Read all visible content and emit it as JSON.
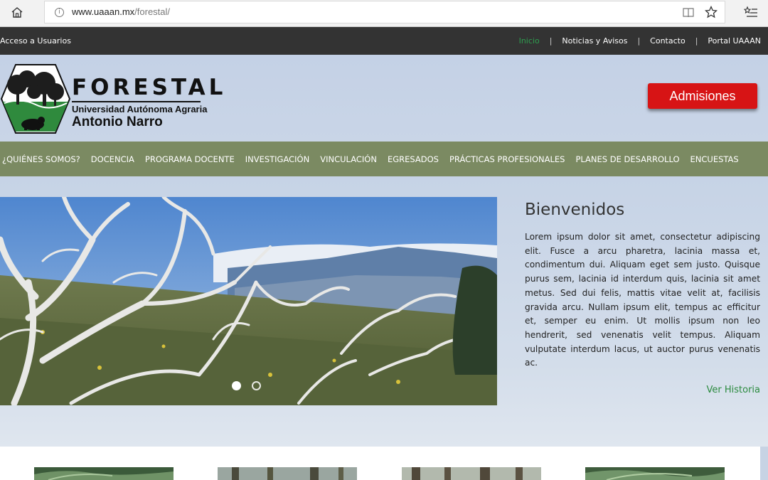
{
  "browser": {
    "url_host": "www.uaaan.mx",
    "url_path": "/forestal/",
    "icons": [
      "home-icon",
      "info-icon",
      "reading-view-icon",
      "favorite-star-icon",
      "favorites-hub-icon"
    ]
  },
  "topbar": {
    "left_link": "Acceso a Usuarios",
    "nav": [
      {
        "label": "Inicio",
        "active": true
      },
      {
        "label": "Noticias y Avisos",
        "active": false
      },
      {
        "label": "Contacto",
        "active": false
      },
      {
        "label": "Portal UAAAN",
        "active": false
      }
    ],
    "separator": "|"
  },
  "header": {
    "logo_title": "FORESTAL",
    "logo_subtitle": "Universidad Autónoma Agraria",
    "logo_name": "Antonio Narro",
    "admissions_label": "Admisiones"
  },
  "mainnav": {
    "items": [
      "¿QUIÉNES SOMOS?",
      "DOCENCIA",
      "PROGRAMA DOCENTE",
      "INVESTIGACIÓN",
      "VINCULACIÓN",
      "EGRESADOS",
      "PRÁCTICAS PROFESIONALES",
      "PLANES DE DESARROLLO",
      "ENCUESTAS"
    ]
  },
  "slider": {
    "slide_count": 2,
    "active_index": 0
  },
  "welcome": {
    "title": "Bienvenidos",
    "text": "Lorem ipsum dolor sit amet, consectetur adipiscing elit. Fusce a arcu pharetra, lacinia massa et, condimentum dui. Aliquam eget sem justo. Quisque purus sem, lacinia id interdum quis, lacinia sit amet metus. Sed dui felis, mattis vitae velit at, facilisis gravida arcu. Nullam ipsum elit, tempus ac efficitur et, semper eu enim. Ut mollis ipsum non leo hendrerit, sed venenatis velit tempus. Aliquam vulputate interdum lacus, ut auctor purus venenatis ac.",
    "link_label": "Ver Historia"
  },
  "colors": {
    "topbar_bg": "#333333",
    "active_link": "#2e9e4f",
    "nav_bg": "#7b8a62",
    "admissions_bg": "#d71415",
    "history_link": "#2b8a3e"
  }
}
